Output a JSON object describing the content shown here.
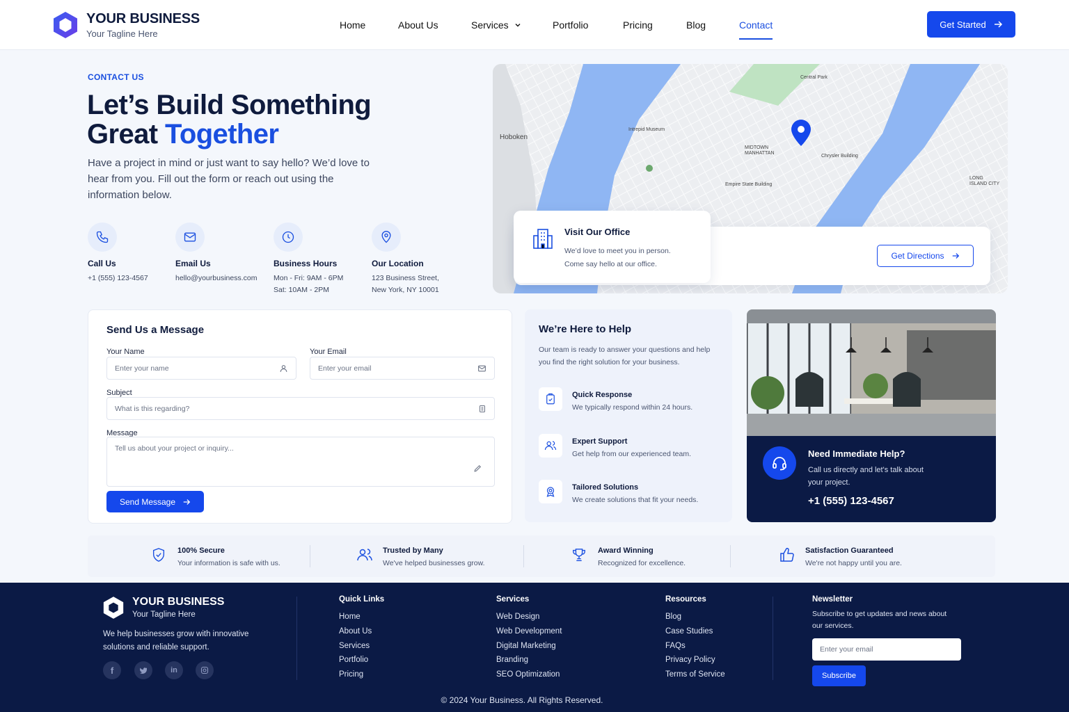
{
  "brand": {
    "name": "YOUR BUSINESS",
    "tagline": "Your Tagline Here"
  },
  "nav": {
    "items": [
      "Home",
      "About Us",
      "Services",
      "Portfolio",
      "Pricing",
      "Blog",
      "Contact"
    ],
    "active": "Contact",
    "cta": "Get Started"
  },
  "hero": {
    "kicker": "CONTACT US",
    "title_line1": "Let’s Build Something",
    "title_line2_plain": "Great ",
    "title_line2_accent": "Together",
    "lead": "Have a project in mind or just want to say hello? We’d love to hear from you. Fill out the form or reach out using the information below."
  },
  "contact_info": [
    {
      "label": "Call Us",
      "value": "+1 (555) 123-4567",
      "icon": "phone-icon"
    },
    {
      "label": "Email Us",
      "value": "hello@yourbusiness.com",
      "icon": "mail-icon"
    },
    {
      "label": "Business Hours",
      "value": "Mon - Fri: 9AM - 6PM\nSat: 10AM - 2PM",
      "icon": "clock-icon"
    },
    {
      "label": "Our Location",
      "value": "123 Business Street,\nNew York, NY 10001",
      "icon": "location-pin-icon"
    }
  ],
  "map": {
    "labels": [
      "Hoboken",
      "MIDTOWN\nMANHATTAN",
      "Empire State Building",
      "Chrysler Building",
      "Intrepid Museum",
      "Central Park",
      "LONG\nISLAND CITY"
    ],
    "office_card": {
      "title": "Visit Our Office",
      "desc_line1": "We’d love to meet you in person.",
      "desc_line2": "Come say hello at our office."
    },
    "directions": "Get Directions"
  },
  "form": {
    "title": "Send Us a Message",
    "name_label": "Your Name",
    "name_placeholder": "Enter your name",
    "email_label": "Your Email",
    "email_placeholder": "Enter your email",
    "subject_label": "Subject",
    "subject_placeholder": "What is this regarding?",
    "message_label": "Message",
    "message_placeholder": "Tell us about your project or inquiry...",
    "submit": "Send Message"
  },
  "help": {
    "title": "We’re Here to Help",
    "desc": "Our team is ready to answer your questions and help you find the right solution for your business.",
    "items": [
      {
        "title": "Quick Response",
        "desc": "We typically respond within 24 hours."
      },
      {
        "title": "Expert Support",
        "desc": "Get help from our experienced team."
      },
      {
        "title": "Tailored Solutions",
        "desc": "We create solutions that fit your needs."
      }
    ]
  },
  "immediate": {
    "title": "Need Immediate Help?",
    "desc": "Call us directly and let's talk about your project.",
    "phone": "+1 (555) 123-4567"
  },
  "features": [
    {
      "title": "100% Secure",
      "desc": "Your information is safe with us."
    },
    {
      "title": "Trusted by Many",
      "desc": "We've helped businesses grow."
    },
    {
      "title": "Award Winning",
      "desc": "Recognized for excellence."
    },
    {
      "title": "Satisfaction Guaranteed",
      "desc": "We're not happy until you are."
    }
  ],
  "footer": {
    "about": "We help businesses grow with innovative solutions and reliable support.",
    "quick_links": {
      "title": "Quick Links",
      "items": [
        "Home",
        "About Us",
        "Services",
        "Portfolio",
        "Pricing"
      ]
    },
    "services": {
      "title": "Services",
      "items": [
        "Web Design",
        "Web Development",
        "Digital Marketing",
        "Branding",
        "SEO Optimization"
      ]
    },
    "resources": {
      "title": "Resources",
      "items": [
        "Blog",
        "Case Studies",
        "FAQs",
        "Privacy Policy",
        "Terms of Service"
      ]
    },
    "newsletter": {
      "title": "Newsletter",
      "desc": "Subscribe to get updates and news about our services.",
      "placeholder": "Enter your email",
      "button": "Subscribe"
    },
    "copyright": "© 2024 Your Business. All Rights Reserved."
  },
  "colors": {
    "accent": "#1548ec",
    "navy": "#0b1a45",
    "text": "#0f1b3d"
  }
}
